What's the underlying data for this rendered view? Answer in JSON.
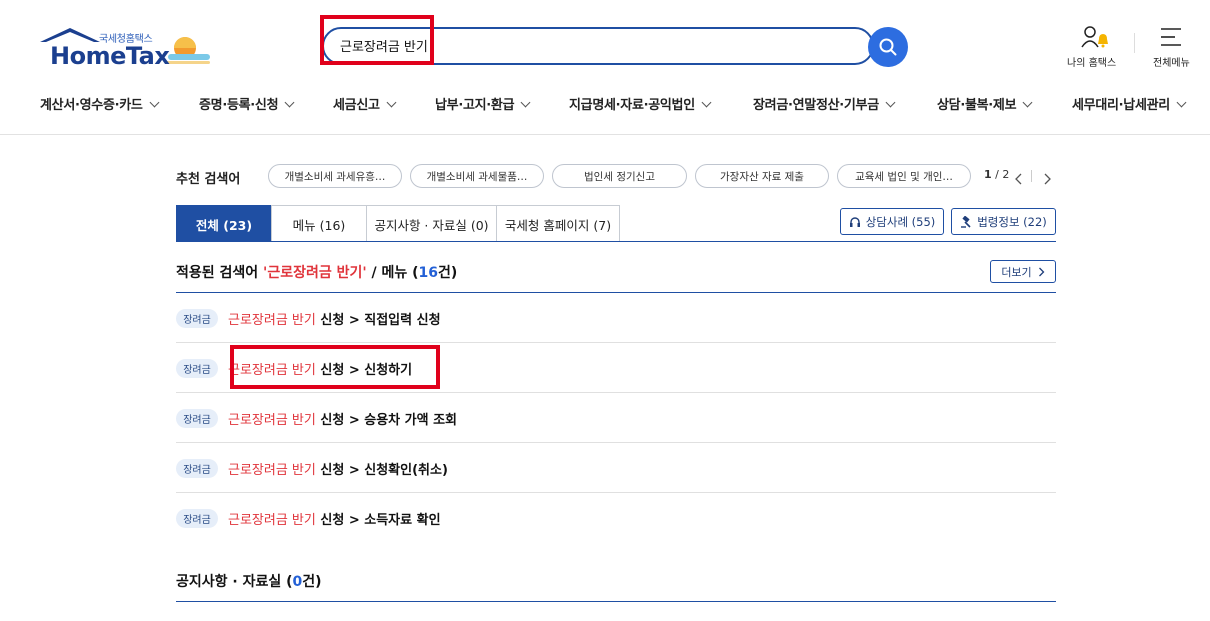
{
  "header": {
    "logo_small": "국세청홈택스",
    "logo_big": "HomeTax",
    "search_value": "근로장려금 반기",
    "my_hometax": "나의 홈택스",
    "all_menu": "전체메뉴"
  },
  "gnb": [
    "계산서·영수증·카드",
    "증명·등록·신청",
    "세금신고",
    "납부·고지·환급",
    "지급명세·자료·공익법인",
    "장려금·연말정산·기부금",
    "상담·불복·제보",
    "세무대리·납세관리"
  ],
  "recommend": {
    "label": "추천 검색어",
    "chips": [
      "개별소비세 과세유흥…",
      "개별소비세 과세물품…",
      "법인세 정기신고",
      "가장자산 자료 제출",
      "교육세 법인 및 개인…"
    ],
    "page_current": "1",
    "page_total": "/ 2"
  },
  "tabs": [
    "전체 (23)",
    "메뉴 (16)",
    "공지사항 · 자료실 (0)",
    "국세청 홈페이지 (7)"
  ],
  "tools": {
    "counsel": "상담사례 (55)",
    "law": "법령정보 (22)"
  },
  "section1": {
    "prefix": "적용된 검색어 ",
    "term": "'근로장려금 반기'",
    "mid": " / 메뉴 (",
    "count": "16",
    "suffix": "건)",
    "more": "더보기"
  },
  "results": [
    {
      "badge": "장려금",
      "hl": "근로장려금 반기",
      "rest": " 신청 > 직접입력 신청"
    },
    {
      "badge": "장려금",
      "hl": "근로장려금 반기",
      "rest": " 신청 > 신청하기"
    },
    {
      "badge": "장려금",
      "hl": "근로장려금 반기",
      "rest": " 신청 > 승용차 가액 조회"
    },
    {
      "badge": "장려금",
      "hl": "근로장려금 반기",
      "rest": " 신청 > 신청확인(취소)"
    },
    {
      "badge": "장려금",
      "hl": "근로장려금 반기",
      "rest": " 신청 > 소득자료 확인"
    }
  ],
  "section2": {
    "prefix": "공지사항 · 자료실 (",
    "count": "0",
    "suffix": "건)"
  },
  "colors": {
    "primary": "#1f4fa3",
    "highlight": "#e0343b",
    "search_button": "#2d6de0",
    "annotation": "#e0001b"
  }
}
